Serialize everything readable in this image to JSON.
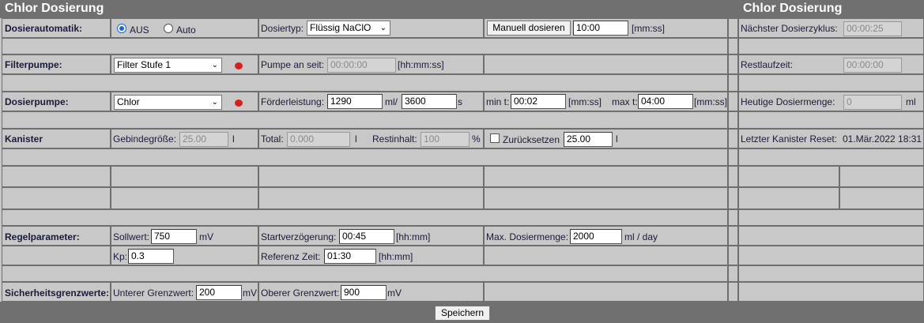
{
  "left_header": "Chlor Dosierung",
  "right_header": "Chlor Dosierung",
  "dosierautomatik": {
    "label": "Dosierautomatik:",
    "radio_aus": "AUS",
    "radio_auto": "Auto",
    "selected": "AUS",
    "typ_label": "Dosiertyp:",
    "typ_value": "Flüssig NaClO",
    "manual_button": "Manuell dosieren",
    "manual_time": "10:00",
    "manual_unit": "[mm:ss]",
    "next_label": "Nächster Dosierzyklus:",
    "next_value": "00:00:25"
  },
  "filterpumpe": {
    "label": "Filterpumpe:",
    "value": "Filter Stufe 1",
    "an_label": "Pumpe an seit:",
    "an_value": "00:00:00",
    "an_unit": "[hh:mm:ss]",
    "rest_label": "Restlaufzeit:",
    "rest_value": "00:00:00"
  },
  "dosierpumpe": {
    "label": "Dosierpumpe:",
    "value": "Chlor",
    "foerder_label": "Förderleistung:",
    "foerder_value": "1290",
    "foerder_unit1": "ml/",
    "foerder_value2": "3600",
    "foerder_unit2": "s",
    "min_label": "min t:",
    "min_value": "00:02",
    "min_unit": "[mm:ss]",
    "max_label": "max t:",
    "max_value": "04:00",
    "max_unit": "[mm:ss]",
    "heute_label": "Heutige Dosiermenge:",
    "heute_value": "0",
    "heute_unit": "ml"
  },
  "kanister": {
    "label": "Kanister",
    "gebinde_label": "Gebindegröße:",
    "gebinde_value": "25.00",
    "gebinde_unit": "l",
    "total_label": "Total:",
    "total_value": "0.000",
    "total_unit": "l",
    "rest_label": "Restinhalt:",
    "rest_value": "100",
    "rest_unit": "%",
    "reset_label": "Zurücksetzen",
    "reset_value": "25.00",
    "reset_unit": "l",
    "letzter_label": "Letzter Kanister Reset:",
    "letzter_value": "01.Mär.2022 18:31"
  },
  "regelparameter": {
    "label": "Regelparameter:",
    "soll_label": "Sollwert:",
    "soll_value": "750",
    "soll_unit": "mV",
    "start_label": "Startverzögerung:",
    "start_value": "00:45",
    "start_unit": "[hh:mm]",
    "maxdos_label": "Max. Dosiermenge:",
    "maxdos_value": "2000",
    "maxdos_unit": "ml / day",
    "kp_label": "Kp:",
    "kp_value": "0.3",
    "ref_label": "Referenz Zeit:",
    "ref_value": "01:30",
    "ref_unit": "[hh:mm]"
  },
  "sicherheit": {
    "label": "Sicherheitsgrenzwerte:",
    "unter_label": "Unterer Grenzwert:",
    "unter_value": "200",
    "unter_unit": "mV",
    "ober_label": "Oberer Grenzwert:",
    "ober_value": "900",
    "ober_unit": "mV"
  },
  "save_button": "Speichern",
  "icons": {
    "status_dot": "red-status-dot-icon",
    "colors": {
      "header": "#707070",
      "status": "#d62020",
      "radio": "#1a66d8"
    }
  }
}
